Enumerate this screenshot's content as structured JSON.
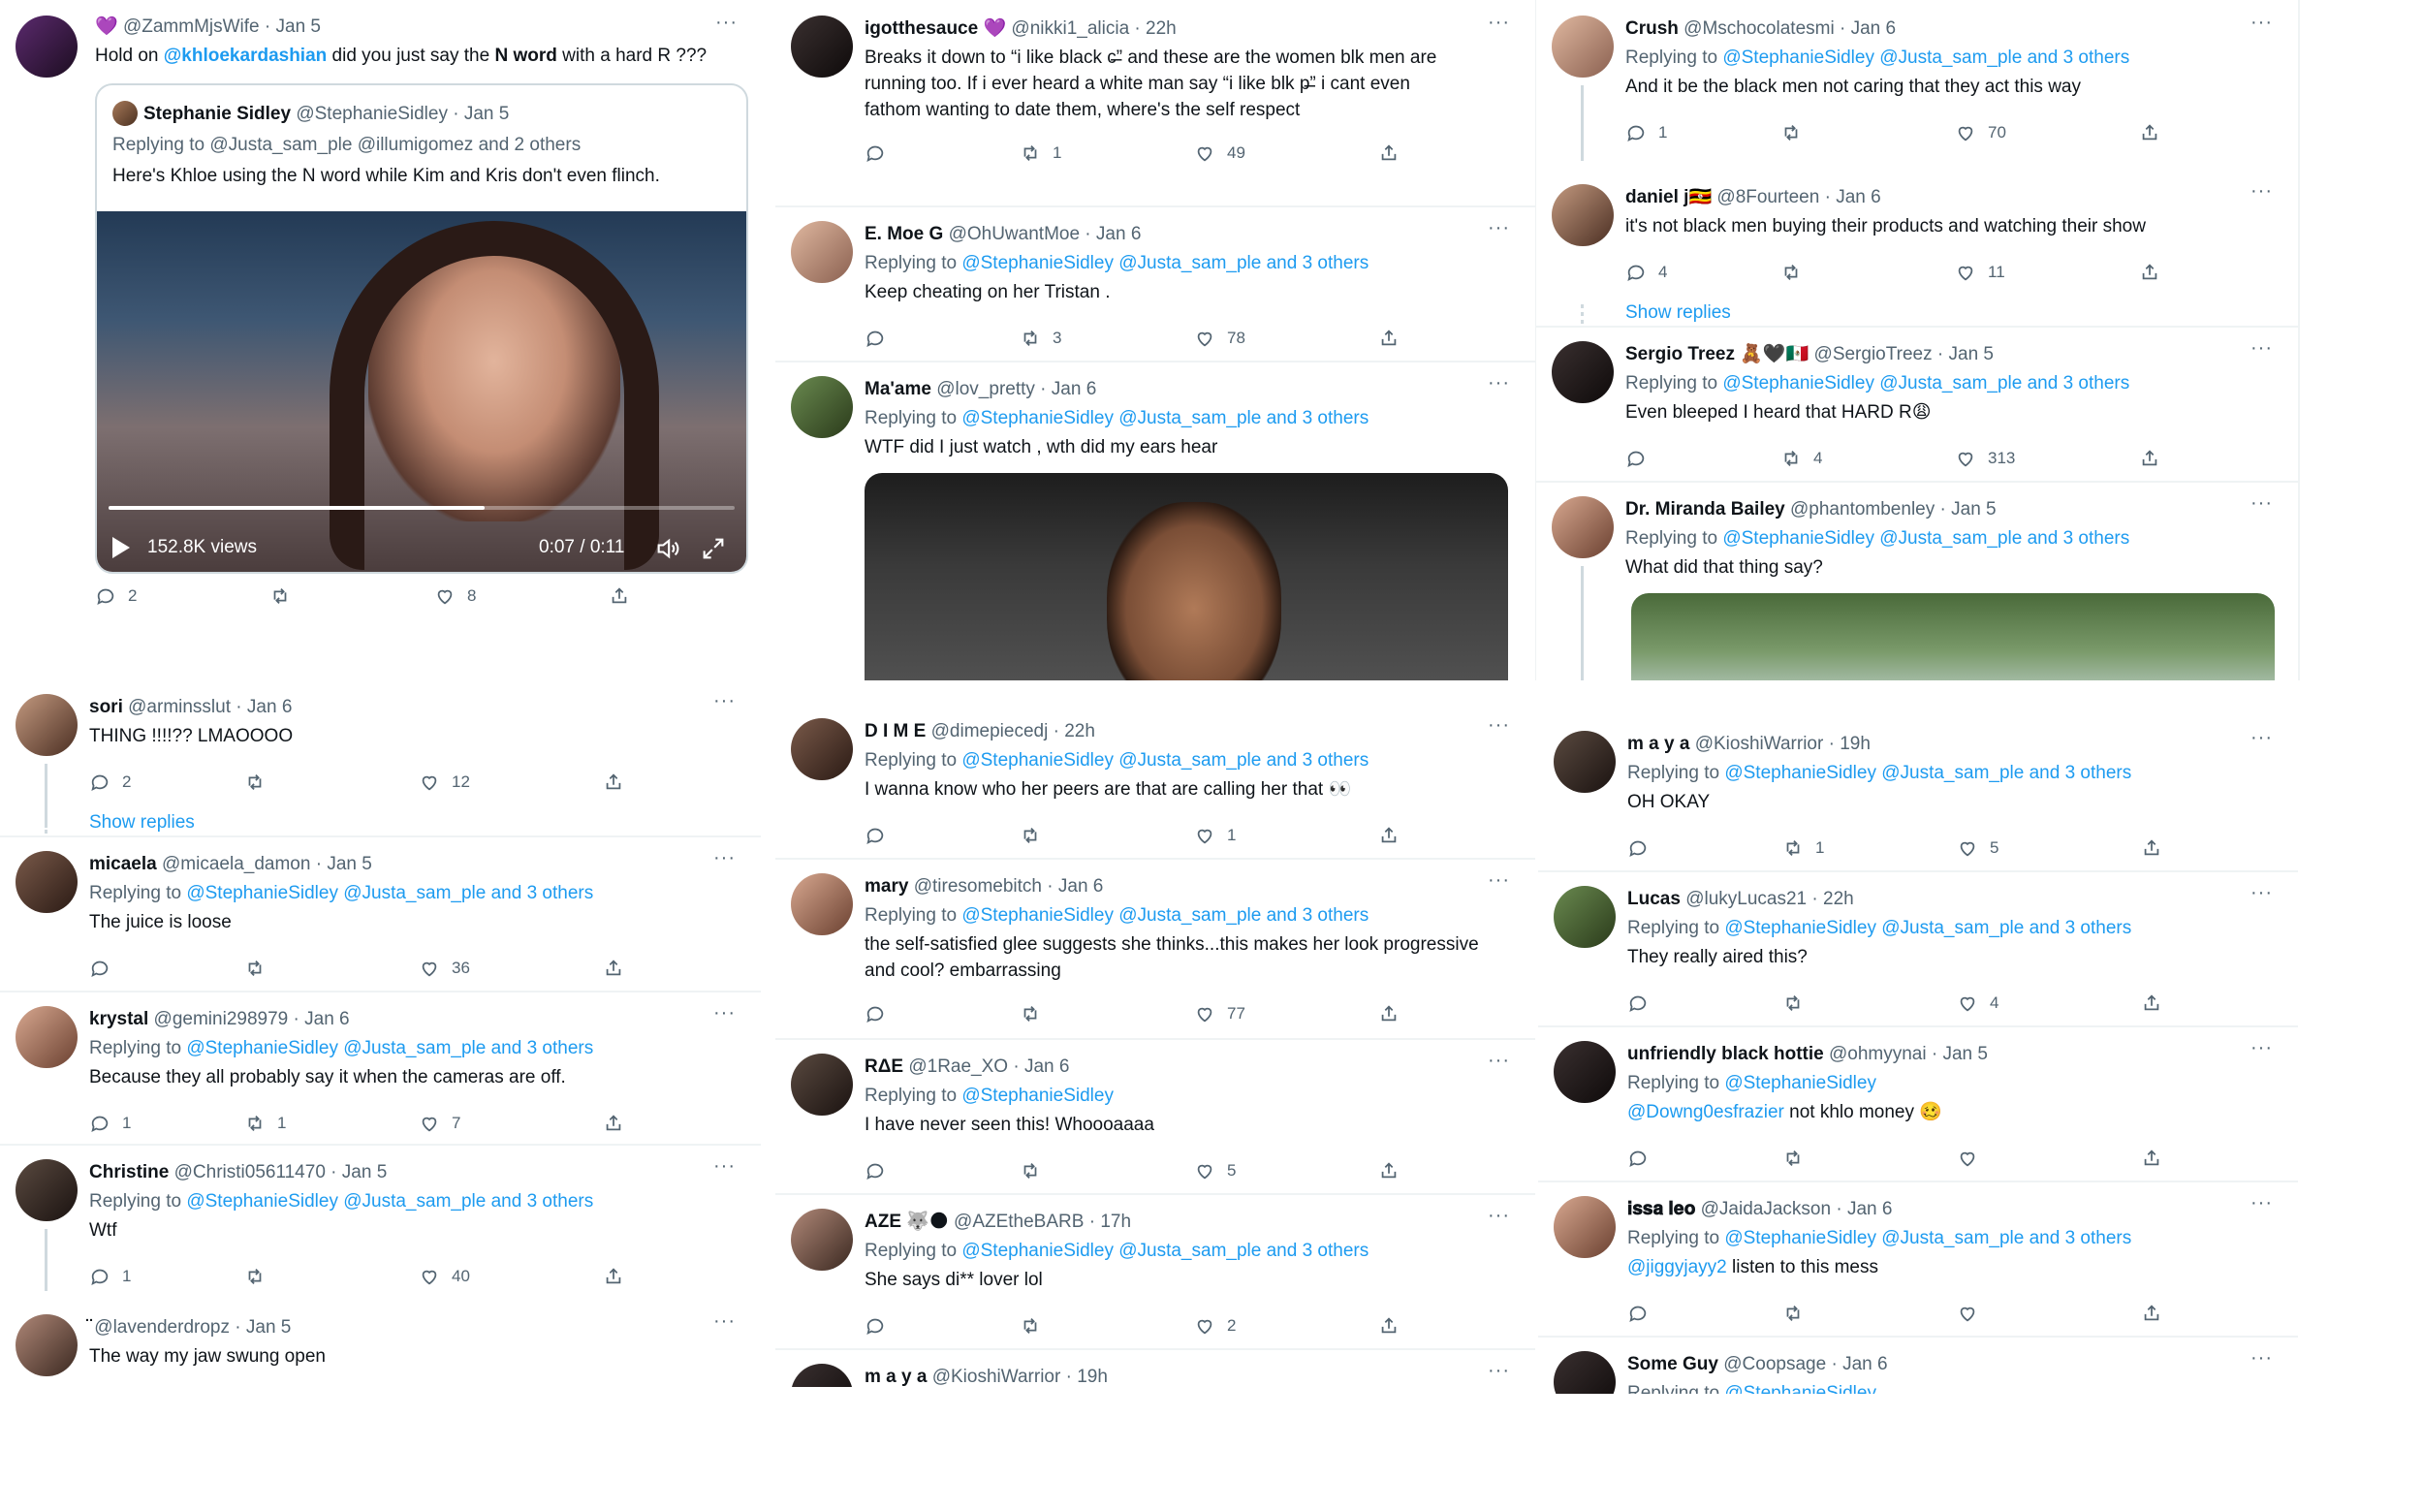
{
  "columns": {
    "left": {
      "main_tweet": {
        "name": "💜",
        "handle": "@ZammMjsWife",
        "time": "Jan 5",
        "text_before": "Hold on ",
        "mention": "@khloekardashian",
        "text_middle": " did you just say the ",
        "bold_text": "N word",
        "text_after": " with a hard R ???",
        "quote": {
          "name": "Stephanie Sidley",
          "handle": "@StephanieSidley",
          "time": "Jan 5",
          "replying": "Replying to @Justa_sam_ple @illumigomez and 2 others",
          "text": "Here's Khloe using the N word while Kim and Kris don't even flinch.",
          "video_views": "152.8K views",
          "video_time": "0:07 / 0:11",
          "progress": 0.6
        },
        "reply_count": "2",
        "retweet_count": "",
        "like_count": "8"
      },
      "replies": [
        {
          "name": "sori",
          "handle": "@arminsslut",
          "time": "Jan 6",
          "replying": "",
          "mentions": "",
          "text": "THING !!!!?? LMAOOOO",
          "reply_count": "2",
          "retweet_count": "",
          "like_count": "12",
          "show_replies": "Show replies"
        },
        {
          "name": "micaela",
          "handle": "@micaela_damon",
          "time": "Jan 5",
          "replying": "Replying to ",
          "mentions": "@StephanieSidley @Justa_sam_ple and 3 others",
          "text": "The juice is loose",
          "reply_count": "",
          "retweet_count": "",
          "like_count": "36"
        },
        {
          "name": "krystal",
          "handle": "@gemini298979",
          "time": "Jan 6",
          "replying": "Replying to ",
          "mentions": "@StephanieSidley @Justa_sam_ple and 3 others",
          "text": "Because they all probably say it when the cameras are off.",
          "reply_count": "1",
          "retweet_count": "1",
          "like_count": "7"
        },
        {
          "name": "Christine",
          "handle": "@Christi05611470",
          "time": "Jan 5",
          "replying": "Replying to ",
          "mentions": "@StephanieSidley @Justa_sam_ple and 3 others",
          "text": "Wtf",
          "reply_count": "1",
          "retweet_count": "",
          "like_count": "40"
        },
        {
          "name": "̈",
          "handle": "@lavenderdropz",
          "time": "Jan 5",
          "replying": "",
          "mentions": "",
          "text": "The way my jaw swung open"
        }
      ]
    },
    "middle_top": [
      {
        "name": "igotthesauce 💜",
        "handle": "@nikki1_alicia",
        "time": "22h",
        "lines": [
          "Breaks it down to “i like black c̶̶̶̶” and these are the women blk men are",
          "running too. If i ever heard a white man say “i like blk p̶̶̶̶̶” i cant even",
          "fathom wanting to date them, where's the self respect"
        ],
        "reply_count": "",
        "retweet_count": "1",
        "like_count": "49"
      },
      {
        "name": "E. Moe G",
        "handle": "@OhUwantMoe",
        "time": "Jan 6",
        "replying": "Replying to ",
        "mentions": "@StephanieSidley @Justa_sam_ple and 3 others",
        "text": "Keep cheating on her Tristan .",
        "reply_count": "",
        "retweet_count": "3",
        "like_count": "78"
      },
      {
        "name": "Ma'ame",
        "handle": "@lov_pretty",
        "time": "Jan 6",
        "replying": "Replying to ",
        "mentions": "@StephanieSidley @Justa_sam_ple and 3 others",
        "text": "WTF did I just watch , wth did my ears hear"
      }
    ],
    "middle_bottom": [
      {
        "name": "D I M E",
        "handle": "@dimepiecedj",
        "time": "22h",
        "replying": "Replying to ",
        "mentions": "@StephanieSidley @Justa_sam_ple and 3 others",
        "text": "I wanna know who her peers are that are calling her that 👀",
        "reply_count": "",
        "retweet_count": "",
        "like_count": "1"
      },
      {
        "name": "mary",
        "handle": "@tiresomebitch",
        "time": "Jan 6",
        "replying": "Replying to ",
        "mentions": "@StephanieSidley @Justa_sam_ple and 3 others",
        "lines": [
          "the self-satisfied glee suggests she thinks...this makes her look progressive",
          "and cool?  embarrassing"
        ],
        "reply_count": "",
        "retweet_count": "",
        "like_count": "77"
      },
      {
        "name": "RΔE",
        "handle": "@1Rae_XO",
        "time": "Jan 6",
        "replying": "Replying to ",
        "mentions": "@StephanieSidley",
        "text": "I have never seen this! Whoooaaaa",
        "reply_count": "",
        "retweet_count": "",
        "like_count": "5"
      },
      {
        "name": "AZE 🐺🌑",
        "handle": "@AZEtheBARB",
        "time": "17h",
        "replying": "Replying to ",
        "mentions": "@StephanieSidley @Justa_sam_ple and 3 others",
        "text": "She says di** lover lol",
        "reply_count": "",
        "retweet_count": "",
        "like_count": "2"
      },
      {
        "name": "m a y a",
        "handle": "@KioshiWarrior",
        "time": "19h"
      }
    ],
    "right_top": [
      {
        "name": "Crush",
        "handle": "@Mschocolatesmi",
        "time": "Jan 6",
        "replying": "Replying to ",
        "mentions": "@StephanieSidley @Justa_sam_ple and 3 others",
        "text": "And it be the black men not caring that  they act this way",
        "reply_count": "1",
        "retweet_count": "",
        "like_count": "70"
      },
      {
        "name": "daniel j🇺🇬",
        "handle": "@8Fourteen",
        "time": "Jan 6",
        "text": "it's not black men buying their products and watching their show",
        "reply_count": "4",
        "retweet_count": "",
        "like_count": "11",
        "show_replies": "Show replies"
      },
      {
        "name": "Sergio Treez 🧸🖤🇲🇽",
        "handle": "@SergioTreez",
        "time": "Jan 5",
        "replying": "Replying to ",
        "mentions": "@StephanieSidley @Justa_sam_ple and 3 others",
        "text": "Even bleeped I heard that HARD R😩",
        "reply_count": "",
        "retweet_count": "4",
        "like_count": "313"
      },
      {
        "name": "Dr. Miranda Bailey",
        "handle": "@phantombenley",
        "time": "Jan 5",
        "replying": "Replying to ",
        "mentions": "@StephanieSidley @Justa_sam_ple and 3 others",
        "text": "What did that thing say?"
      }
    ],
    "right_bottom": [
      {
        "name": "m a y a",
        "handle": "@KioshiWarrior",
        "time": "19h",
        "replying": "Replying to ",
        "mentions": "@StephanieSidley @Justa_sam_ple and 3 others",
        "text": "OH OKAY",
        "reply_count": "",
        "retweet_count": "1",
        "like_count": "5"
      },
      {
        "name": "Lucas",
        "handle": "@lukyLucas21",
        "time": "22h",
        "replying": "Replying to ",
        "mentions": "@StephanieSidley @Justa_sam_ple and 3 others",
        "text": "They really aired this?",
        "reply_count": "",
        "retweet_count": "",
        "like_count": "4"
      },
      {
        "name": "unfriendly black hottie",
        "handle": "@ohmyynai",
        "time": "Jan 5",
        "replying": "Replying to ",
        "mentions": "@StephanieSidley",
        "mention2": "@Downg0esfrazier",
        "text": " not khlo money 🥴",
        "reply_count": "",
        "retweet_count": "",
        "like_count": ""
      },
      {
        "name": "𝐢𝐬𝐬𝐚 𝐥𝐞𝐨",
        "handle": "@JaidaJackson",
        "time": "Jan 6",
        "replying": "Replying to ",
        "mentions": "@StephanieSidley @Justa_sam_ple and 3 others",
        "mention2": "@jiggyjayy2",
        "text": " listen to this mess",
        "reply_count": "",
        "retweet_count": "",
        "like_count": ""
      },
      {
        "name": "Some Guy",
        "handle": "@Coopsage",
        "time": "Jan 6",
        "replying": "Replying to ",
        "mentions": "@StephanieSidley"
      }
    ]
  },
  "ui": {
    "dot_separator": " · ",
    "more_glyph": "···"
  }
}
